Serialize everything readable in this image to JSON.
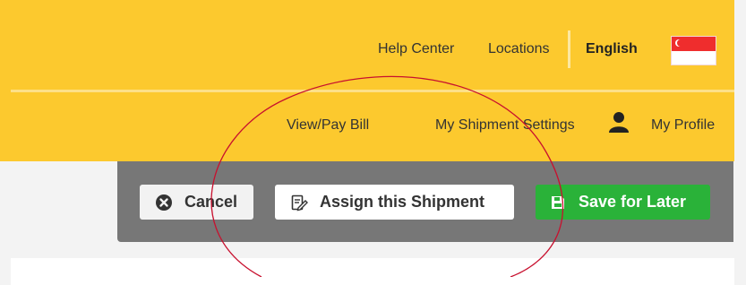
{
  "header": {
    "utility_links": [
      {
        "label": "Help Center"
      },
      {
        "label": "Locations"
      }
    ],
    "language": "English",
    "flag": "singapore-flag",
    "nav_links": [
      {
        "label": "View/Pay Bill"
      },
      {
        "label": "My Shipment Settings"
      }
    ],
    "profile": {
      "label": "My Profile",
      "icon": "user-icon"
    }
  },
  "actions": {
    "cancel": {
      "label": "Cancel",
      "icon": "close-circle-icon"
    },
    "assign": {
      "label": "Assign this Shipment",
      "icon": "edit-document-icon"
    },
    "save": {
      "label": "Save for Later",
      "icon": "save-icon"
    }
  },
  "colors": {
    "brand_yellow": "#fcc92e",
    "action_bar": "#777777",
    "save_green": "#2ab239",
    "annotation_red": "#c8102e"
  }
}
